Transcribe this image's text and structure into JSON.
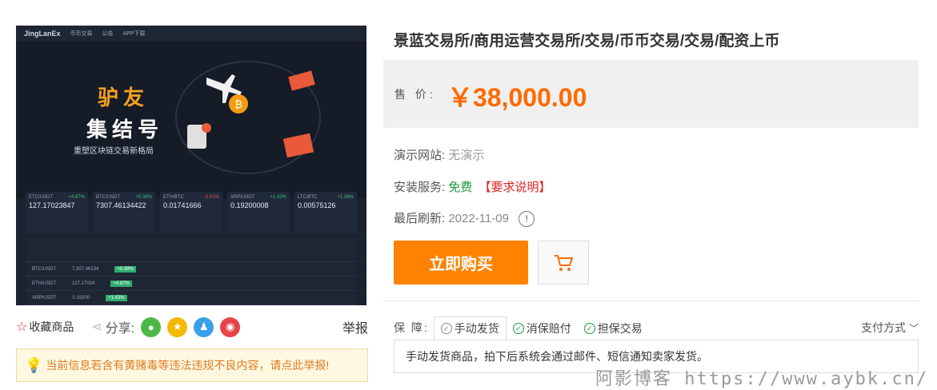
{
  "preview": {
    "logo": "JingLanEx",
    "nav": [
      "币币交易",
      "公告",
      "APP下载"
    ],
    "hero_line1": "驴友",
    "hero_line2": "集结号",
    "hero_line3": "重塑区块链交易新格局",
    "tickers": [
      {
        "pair": "ETC/USDT",
        "price": "127.17023847",
        "change": "+4.87%",
        "up": true
      },
      {
        "pair": "BTC/USDT",
        "price": "7307.46134422",
        "change": "+0.38%",
        "up": true
      },
      {
        "pair": "ETH/BTC",
        "price": "0.01741666",
        "change": "-0.51%",
        "up": false
      },
      {
        "pair": "XRP/USDT",
        "price": "0.19200008",
        "change": "+1.43%",
        "up": true
      },
      {
        "pair": "LTC/BTC",
        "price": "0.00575126",
        "change": "+1.38%",
        "up": true
      }
    ],
    "table_rows": [
      {
        "pair": "BTC/USDT",
        "price": "7,307.46134",
        "change": "+0.38%"
      },
      {
        "pair": "ETH/USDT",
        "price": "127.17024",
        "change": "+4.87%"
      },
      {
        "pair": "XRP/USDT",
        "price": "0.19200",
        "change": "+1.43%"
      }
    ]
  },
  "actions": {
    "favorite": "收藏商品",
    "share": "分享:",
    "report": "举报"
  },
  "notice": "当前信息若含有黄赌毒等违法违规不良内容，请点此举报!",
  "product": {
    "title": "景蓝交易所/商用运营交易所/交易/币币交易/交易/配资上币",
    "price_label": "售 价:",
    "price": "￥38,000.00",
    "demo_label": "演示网站:",
    "demo_value": "无演示",
    "install_label": "安装服务:",
    "install_value": "免费",
    "install_note": "【要求说明】",
    "refresh_label": "最后刷新:",
    "refresh_value": "2022-11-09",
    "buy_button": "立即购买"
  },
  "guarantee": {
    "label": "保 障:",
    "tabs": [
      "手动发货",
      "消保赔付",
      "担保交易"
    ],
    "payment": "支付方式",
    "description": "手动发货商品，拍下后系统会通过邮件、短信通知卖家发货。"
  },
  "watermark": "阿影博客 https://www.aybk.cn/",
  "colors": {
    "price": "#ff6a00",
    "buy_button": "#ff8200",
    "free": "#1a9a3a",
    "warning": "#e02020"
  }
}
